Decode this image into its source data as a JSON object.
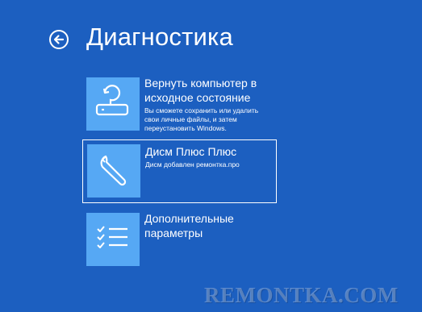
{
  "page": {
    "title": "Диагностика",
    "background_color": "#1c5fc0"
  },
  "back": {
    "icon": "back-arrow-icon"
  },
  "options": [
    {
      "title_line1": "Вернуть компьютер в",
      "title_line2": "исходное состояние",
      "desc_line1": "Вы сможете сохранить или удалить",
      "desc_line2": "свои личные файлы, и затем",
      "desc_line3": "переустановить Windows.",
      "icon": "reset-pc-icon",
      "selected": false
    },
    {
      "title_line1": "Дисм Плюс Плюс",
      "desc_line1": "Дисм добавлен ремонтка.про",
      "icon": "wrench-icon",
      "selected": true
    },
    {
      "title_line1": "Дополнительные",
      "title_line2": "параметры",
      "icon": "checklist-icon",
      "selected": false
    }
  ],
  "tile_color": "#56a8f4",
  "watermark": {
    "text": "REMONTKA.COM"
  }
}
